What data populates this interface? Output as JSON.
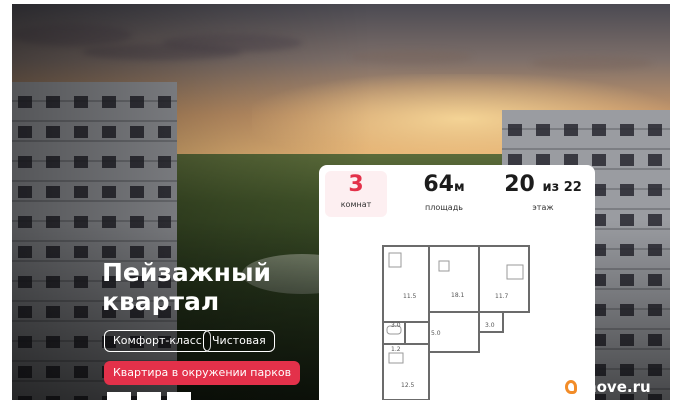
{
  "banner": {
    "title_line1": "Пейзажный",
    "title_line2": "квартал",
    "tags": [
      "Комфорт-класс",
      "Чистовая"
    ],
    "highlight": "Квартира в окружении парков"
  },
  "apartment": {
    "rooms_value": "3",
    "rooms_label": "комнат",
    "area_value": "64",
    "area_unit": "м",
    "area_label": "площадь",
    "floor_value": "20",
    "floor_of": "из 22",
    "floor_label": "этаж"
  },
  "floor_plan": {
    "rooms": [
      "11.5",
      "18.1",
      "11.7",
      "3.0",
      "1.2",
      "5.0",
      "3.0",
      "12.5"
    ]
  },
  "logo": {
    "text": "move.ru"
  },
  "colors": {
    "accent": "#e3314a",
    "logo": "#f28c28"
  }
}
